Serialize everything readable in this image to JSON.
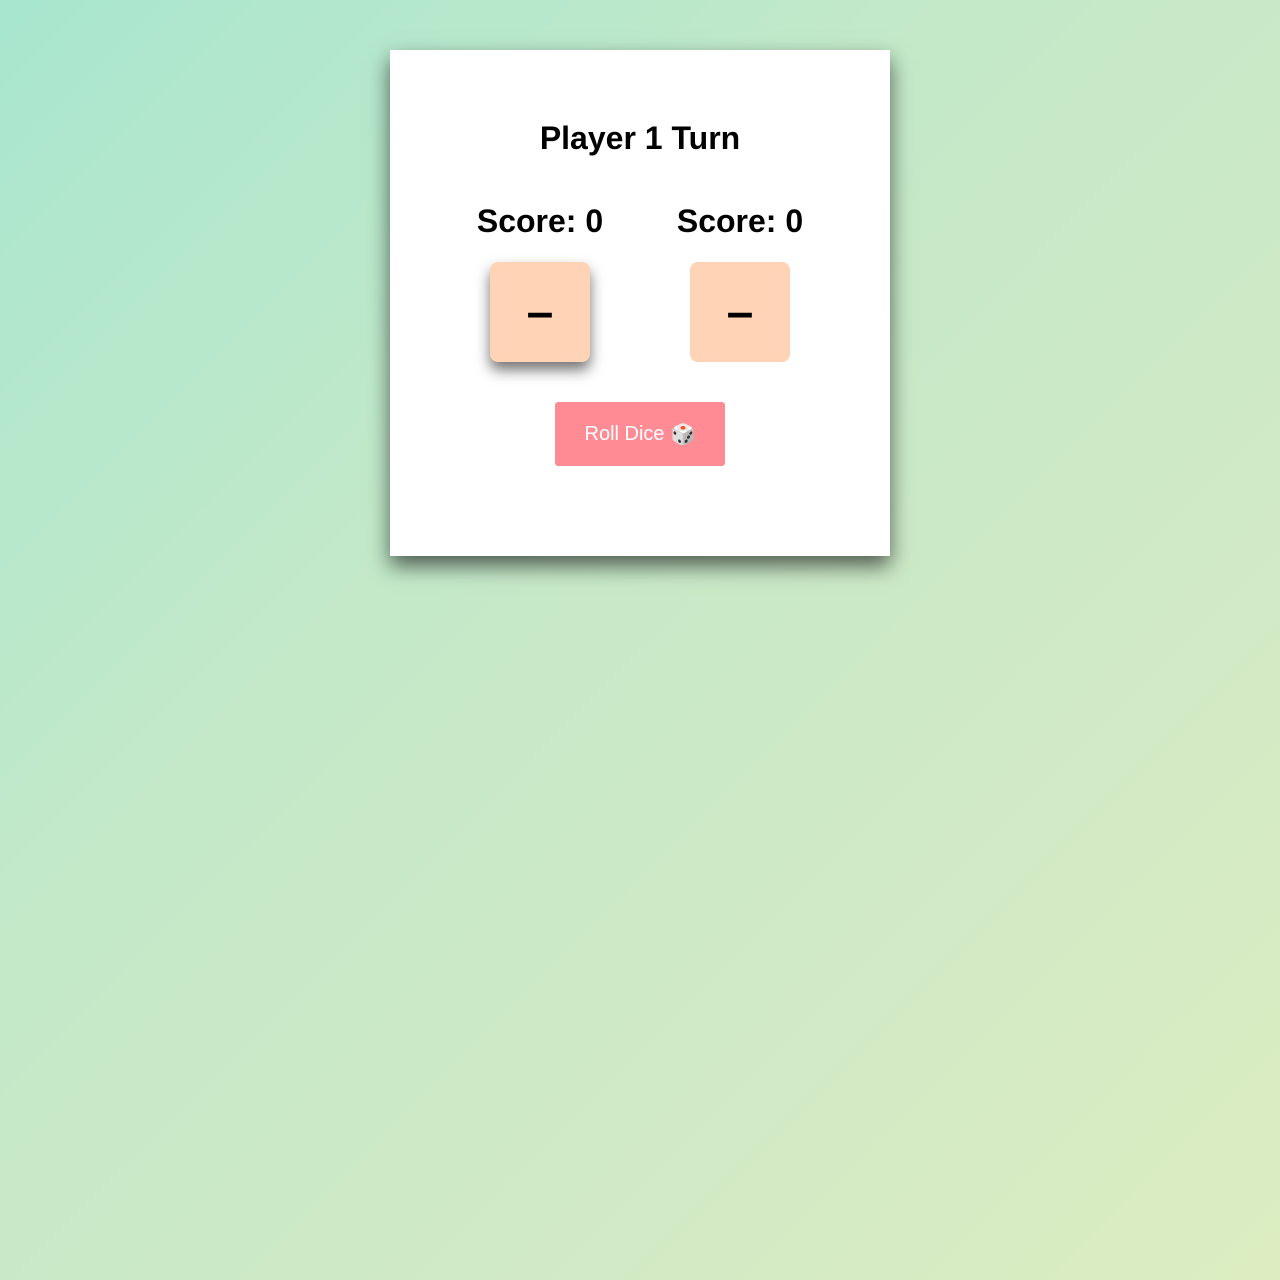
{
  "game": {
    "turn_title": "Player 1 Turn",
    "active_player": 1
  },
  "players": [
    {
      "score_label": "Score: 0",
      "die_face": "–"
    },
    {
      "score_label": "Score: 0",
      "die_face": "–"
    }
  ],
  "roll_button": {
    "label": "Roll Dice",
    "icon": "🎲",
    "icon_name": "dice-icon"
  },
  "colors": {
    "die": "#ffd3b6",
    "button": "#ff8b94",
    "background_start": "#a8e6cf",
    "background_end": "#dcedc1"
  }
}
